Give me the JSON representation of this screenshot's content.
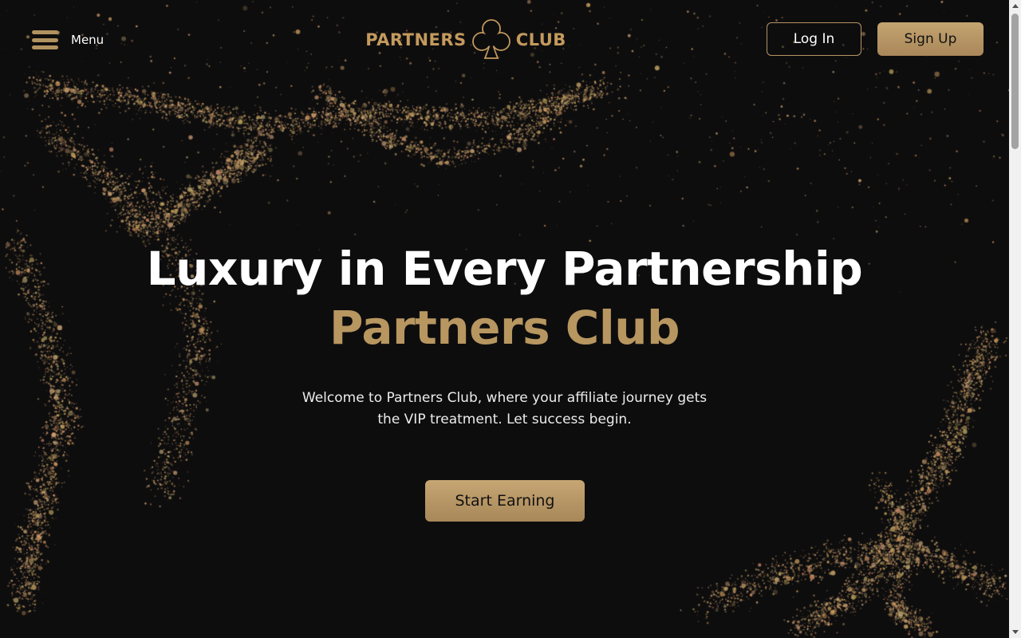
{
  "header": {
    "menu_label": "Menu",
    "logo_left": "PARTNERS",
    "logo_right": "CLUB",
    "login_label": "Log In",
    "signup_label": "Sign Up"
  },
  "hero": {
    "headline": "Luxury in Every Partnership",
    "headline_gold": "Partners Club",
    "subtitle": "Welcome to Partners Club, where your affiliate journey gets the VIP treatment. Let success begin.",
    "cta_label": "Start Earning"
  },
  "icons": {
    "menu": "hamburger-icon",
    "logo": "club-suit-icon",
    "scroll_up": "scroll-up-arrow-icon",
    "scroll_down": "scroll-down-arrow-icon"
  },
  "colors": {
    "background": "#0e0d0e",
    "gold": "#b79660",
    "gold_light": "#c6a673",
    "text": "#ffffff"
  }
}
